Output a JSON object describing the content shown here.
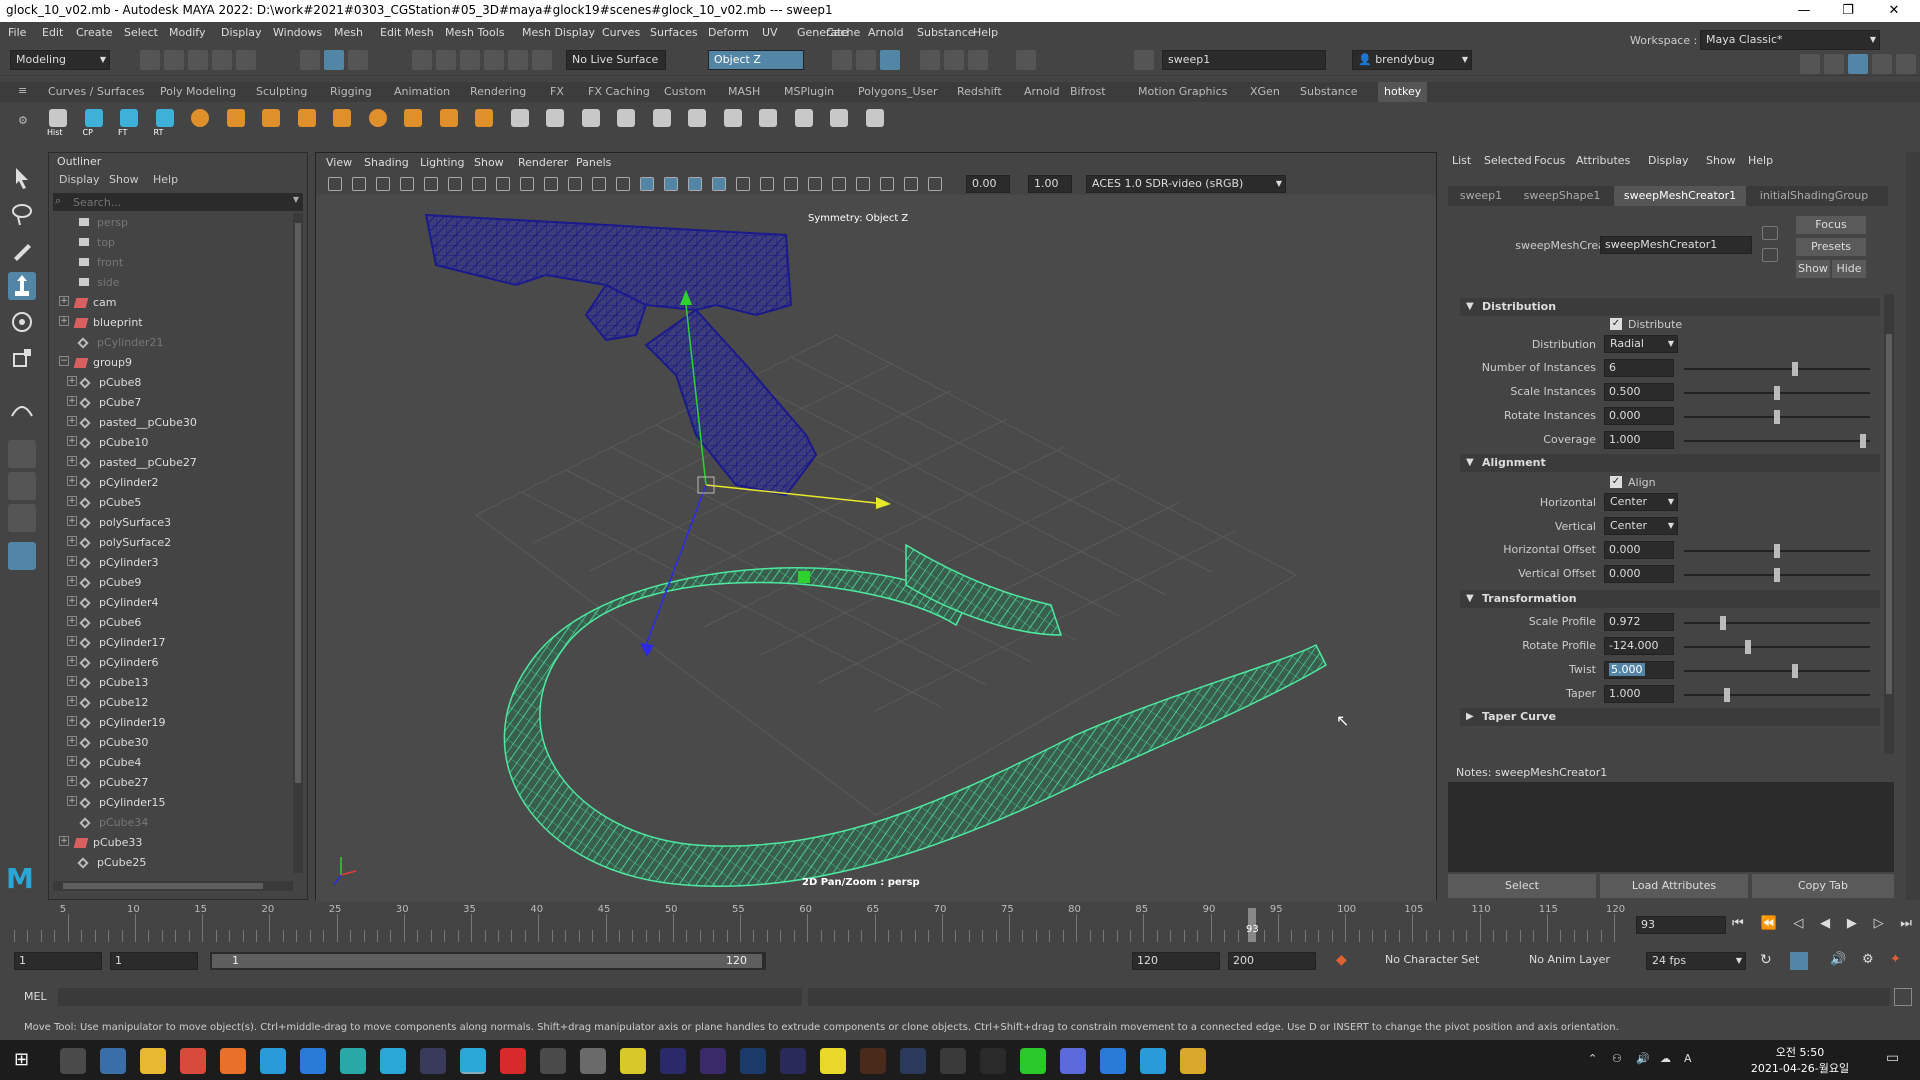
{
  "window": {
    "title": "glock_10_v02.mb - Autodesk MAYA 2022: D:\\work#2021#0303_CGStation#05_3D#maya#glock19#scenes#glock_10_v02.mb   ---   sweep1"
  },
  "menu": [
    "File",
    "Edit",
    "Create",
    "Select",
    "Modify",
    "Display",
    "Windows",
    "Mesh",
    "Edit Mesh",
    "Mesh Tools",
    "Mesh Display",
    "Curves",
    "Surfaces",
    "Deform",
    "UV",
    "Generate",
    "Cache",
    "Arnold",
    "Substance",
    "Help"
  ],
  "workspace": {
    "label": "Workspace :",
    "value": "Maya Classic*"
  },
  "status": {
    "mode": "Modeling",
    "live": "No Live Surface",
    "symmetry": "Object Z",
    "node": "sweep1",
    "user": "brendybug"
  },
  "shelf_tabs": [
    "Curves / Surfaces",
    "Poly Modeling",
    "Sculpting",
    "Rigging",
    "Animation",
    "Rendering",
    "FX",
    "FX Caching",
    "Custom",
    "MASH",
    "MSPlugin",
    "Polygons_User",
    "Redshift",
    "Arnold",
    "Bifrost",
    "Motion Graphics",
    "XGen",
    "Substance",
    "hotkey"
  ],
  "shelf_labels": [
    "Hist",
    "CP",
    "FT",
    "RT"
  ],
  "outliner": {
    "title": "Outliner",
    "menu": [
      "Display",
      "Show",
      "Help"
    ],
    "search": "Search...",
    "items": [
      {
        "label": "persp",
        "type": "cam",
        "dim": true,
        "indent": 1
      },
      {
        "label": "top",
        "type": "cam",
        "dim": true,
        "indent": 1
      },
      {
        "label": "front",
        "type": "cam",
        "dim": true,
        "indent": 1
      },
      {
        "label": "side",
        "type": "cam",
        "dim": true,
        "indent": 1
      },
      {
        "label": "cam",
        "type": "grp",
        "indent": 0,
        "exp": "+"
      },
      {
        "label": "blueprint",
        "type": "grp",
        "indent": 0,
        "exp": "+"
      },
      {
        "label": "pCylinder21",
        "type": "mesh",
        "dim": true,
        "indent": 1
      },
      {
        "label": "group9",
        "type": "grp",
        "indent": 0,
        "exp": "−"
      },
      {
        "label": "pCube8",
        "type": "mesh",
        "indent": 2,
        "exp": "+"
      },
      {
        "label": "pCube7",
        "type": "mesh",
        "indent": 2,
        "exp": "+"
      },
      {
        "label": "pasted__pCube30",
        "type": "mesh",
        "indent": 2,
        "exp": "+"
      },
      {
        "label": "pCube10",
        "type": "mesh",
        "indent": 2,
        "exp": "+"
      },
      {
        "label": "pasted__pCube27",
        "type": "mesh",
        "indent": 2,
        "exp": "+"
      },
      {
        "label": "pCylinder2",
        "type": "mesh",
        "indent": 2,
        "exp": "+"
      },
      {
        "label": "pCube5",
        "type": "mesh",
        "indent": 2,
        "exp": "+"
      },
      {
        "label": "polySurface3",
        "type": "mesh",
        "indent": 2,
        "exp": "+"
      },
      {
        "label": "polySurface2",
        "type": "mesh",
        "indent": 2,
        "exp": "+"
      },
      {
        "label": "pCylinder3",
        "type": "mesh",
        "indent": 2,
        "exp": "+"
      },
      {
        "label": "pCube9",
        "type": "mesh",
        "indent": 2,
        "exp": "+"
      },
      {
        "label": "pCylinder4",
        "type": "mesh",
        "indent": 2,
        "exp": "+"
      },
      {
        "label": "pCube6",
        "type": "mesh",
        "indent": 2,
        "exp": "+"
      },
      {
        "label": "pCylinder17",
        "type": "mesh",
        "indent": 2,
        "exp": "+"
      },
      {
        "label": "pCylinder6",
        "type": "mesh",
        "indent": 2,
        "exp": "+"
      },
      {
        "label": "pCube13",
        "type": "mesh",
        "indent": 2,
        "exp": "+"
      },
      {
        "label": "pCube12",
        "type": "mesh",
        "indent": 2,
        "exp": "+"
      },
      {
        "label": "pCylinder19",
        "type": "mesh",
        "indent": 2,
        "exp": "+"
      },
      {
        "label": "pCube30",
        "type": "mesh",
        "indent": 2,
        "exp": "+"
      },
      {
        "label": "pCube4",
        "type": "mesh",
        "indent": 2,
        "exp": "+"
      },
      {
        "label": "pCube27",
        "type": "mesh",
        "indent": 2,
        "exp": "+"
      },
      {
        "label": "pCylinder15",
        "type": "mesh",
        "indent": 2,
        "exp": "+"
      },
      {
        "label": "pCube34",
        "type": "mesh",
        "dim": true,
        "indent": 2
      },
      {
        "label": "pCube33",
        "type": "grp",
        "indent": 0,
        "exp": "+"
      },
      {
        "label": "pCube25",
        "type": "mesh",
        "indent": 1
      }
    ]
  },
  "viewport": {
    "menu": [
      "View",
      "Shading",
      "Lighting",
      "Show",
      "Renderer",
      "Panels"
    ],
    "field1": "0.00",
    "field2": "1.00",
    "colorspace": "ACES 1.0 SDR-video (sRGB)",
    "symmetry_label": "Symmetry: Object Z",
    "hud": "2D Pan/Zoom : persp"
  },
  "attr": {
    "menu": [
      "List",
      "Selected",
      "Focus",
      "Attributes",
      "Display",
      "Show",
      "Help"
    ],
    "tabs": [
      "sweep1",
      "sweepShape1",
      "sweepMeshCreator1",
      "initialShadingGroup"
    ],
    "node_label": "sweepMeshCreator:",
    "node_value": "sweepMeshCreator1",
    "side_buttons": [
      "Focus",
      "Presets",
      "Show",
      "Hide"
    ],
    "sections": {
      "distribution": "Distribution",
      "alignment": "Alignment",
      "transformation": "Transformation",
      "taper": "Taper Curve"
    },
    "distribute": "Distribute",
    "distribution_label": "Distribution",
    "distribution_value": "Radial",
    "fields": {
      "instances": {
        "label": "Number of Instances",
        "value": "6",
        "pos": 0.6
      },
      "scale_inst": {
        "label": "Scale Instances",
        "value": "0.500",
        "pos": 0.5
      },
      "rotate_inst": {
        "label": "Rotate Instances",
        "value": "0.000",
        "pos": 0.5
      },
      "coverage": {
        "label": "Coverage",
        "value": "1.000",
        "pos": 0.98
      },
      "h_offset": {
        "label": "Horizontal Offset",
        "value": "0.000",
        "pos": 0.5
      },
      "v_offset": {
        "label": "Vertical Offset",
        "value": "0.000",
        "pos": 0.5
      },
      "scale_profile": {
        "label": "Scale Profile",
        "value": "0.972",
        "pos": 0.2
      },
      "rotate_profile": {
        "label": "Rotate Profile",
        "value": "-124.000",
        "pos": 0.34
      },
      "twist": {
        "label": "Twist",
        "value": "5.000",
        "pos": 0.6
      },
      "taper": {
        "label": "Taper",
        "value": "1.000",
        "pos": 0.22
      }
    },
    "align": "Align",
    "horizontal_label": "Horizontal",
    "horizontal_value": "Center",
    "vertical_label": "Vertical",
    "vertical_value": "Center",
    "notes": "Notes:  sweepMeshCreator1",
    "bottom_buttons": [
      "Select",
      "Load Attributes",
      "Copy Tab"
    ]
  },
  "timeline": {
    "ticks": [
      "5",
      "10",
      "15",
      "20",
      "25",
      "30",
      "35",
      "40",
      "45",
      "50",
      "55",
      "60",
      "65",
      "70",
      "75",
      "80",
      "85",
      "90",
      "95",
      "100",
      "105",
      "110",
      "115",
      "120"
    ],
    "current": "93",
    "frame_field": "93"
  },
  "range": {
    "start": "1",
    "start2": "1",
    "slider_start": "1",
    "slider_end": "120",
    "end": "120",
    "end2": "200",
    "charset": "No Character Set",
    "animlayer": "No Anim Layer",
    "fps": "24 fps"
  },
  "cmd": {
    "label": "MEL"
  },
  "help": "Move Tool: Use manipulator to move object(s). Ctrl+middle-drag to move components along normals. Shift+drag manipulator axis or plane handles to extrude components or clone objects. Ctrl+Shift+drag to constrain movement to a connected edge. Use D or INSERT to change the pivot position and axis orientation.",
  "clock": {
    "time": "오전 5:50",
    "date": "2021-04-26-월요일"
  },
  "colors": {
    "wire_green": "#4ee8a0",
    "wire_blue": "#1a1a8c",
    "accent": "#5285a6"
  }
}
